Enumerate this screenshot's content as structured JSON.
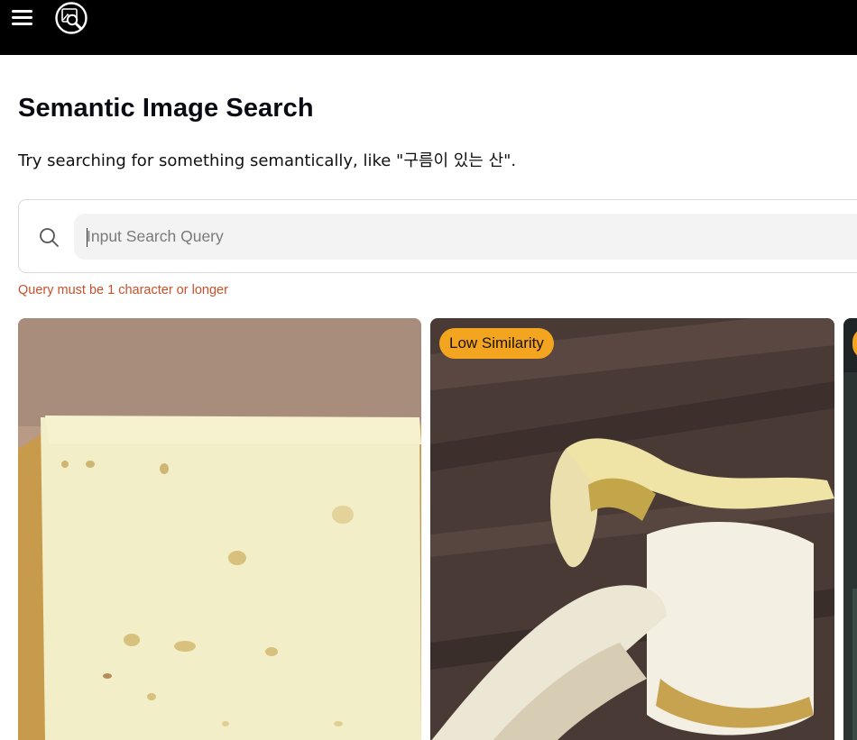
{
  "header": {
    "menu_icon": "hamburger-menu-icon",
    "logo_icon": "image-search-logo-icon"
  },
  "page": {
    "title": "Semantic Image Search",
    "subtitle": "Try searching for something semantically, like \"구름이 있는 산\"."
  },
  "search": {
    "icon": "search-icon",
    "placeholder": "Input Search Query",
    "value": "",
    "error": "Query must be 1 character or longer"
  },
  "results": [
    {
      "image": "cheese-slice",
      "badge": ""
    },
    {
      "image": "peeled-banana",
      "badge": "Low Similarity"
    },
    {
      "image": "dark-photo",
      "badge": ""
    }
  ],
  "colors": {
    "header_bg": "#000000",
    "badge_bg": "#f4a51f",
    "error_text": "#c8502a",
    "input_bg": "#f3f3f3"
  }
}
